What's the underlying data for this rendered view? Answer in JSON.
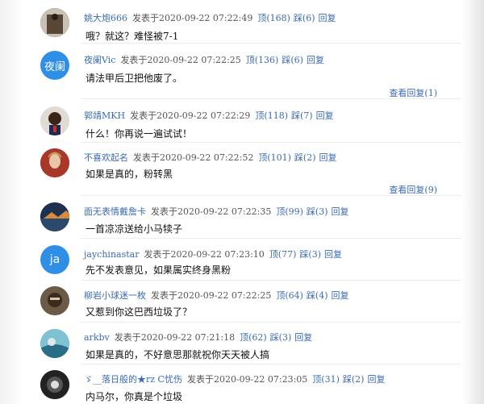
{
  "comments": [
    {
      "user": "姚大炮666",
      "posted": "发表于2020-09-22 07:22:49",
      "up": "顶(168)",
      "down": "踩(6)",
      "reply": "回复",
      "text": "哦？就这？难怪被7-1",
      "avatar_text": ""
    },
    {
      "user": "夜阑Vic",
      "posted": "发表于2020-09-22 07:22:25",
      "up": "顶(136)",
      "down": "踩(6)",
      "reply": "回复",
      "text": "请法甲后卫把他废了。",
      "avatar_text": "夜阑",
      "view_replies": "查看回复(1)"
    },
    {
      "user": "郭靖MKH",
      "posted": "发表于2020-09-22 07:22:29",
      "up": "顶(118)",
      "down": "踩(7)",
      "reply": "回复",
      "text": "什么！你再说一遍试试！",
      "avatar_text": ""
    },
    {
      "user": "不喜欢起名",
      "posted": "发表于2020-09-22 07:22:52",
      "up": "顶(101)",
      "down": "踩(2)",
      "reply": "回复",
      "text": "如果是真的，粉转黑",
      "avatar_text": "",
      "view_replies": "查看回复(9)"
    },
    {
      "user": "面无表情戴詹卡",
      "posted": "发表于2020-09-22 07:22:35",
      "up": "顶(99)",
      "down": "踩(3)",
      "reply": "回复",
      "text": "一首凉凉送给小马犊子",
      "avatar_text": ""
    },
    {
      "user": "jaychinastar",
      "posted": "发表于2020-09-22 07:23:10",
      "up": "顶(77)",
      "down": "踩(3)",
      "reply": "回复",
      "text": "先不发表意见，如果属实终身黑粉",
      "avatar_text": "ja"
    },
    {
      "user": "柳岩小球迷一枚",
      "posted": "发表于2020-09-22 07:22:25",
      "up": "顶(64)",
      "down": "踩(4)",
      "reply": "回复",
      "text": "又惹到你这巴西垃圾了？",
      "avatar_text": ""
    },
    {
      "user": "arkbv",
      "posted": "发表于2020-09-22 07:21:18",
      "up": "顶(62)",
      "down": "踩(3)",
      "reply": "回复",
      "text": "如果是真的，不好意思那就祝你天天被人搞",
      "avatar_text": ""
    },
    {
      "user": "ゞ__落日般的★rz C忧伤",
      "posted": "发表于2020-09-22 07:23:05",
      "up": "顶(31)",
      "down": "踩(2)",
      "reply": "回复",
      "text": "内马尔，你真是个垃圾",
      "avatar_text": ""
    }
  ],
  "colors": {
    "link": "#3a6bb0",
    "avatar_blue": "#2f8fe6"
  }
}
